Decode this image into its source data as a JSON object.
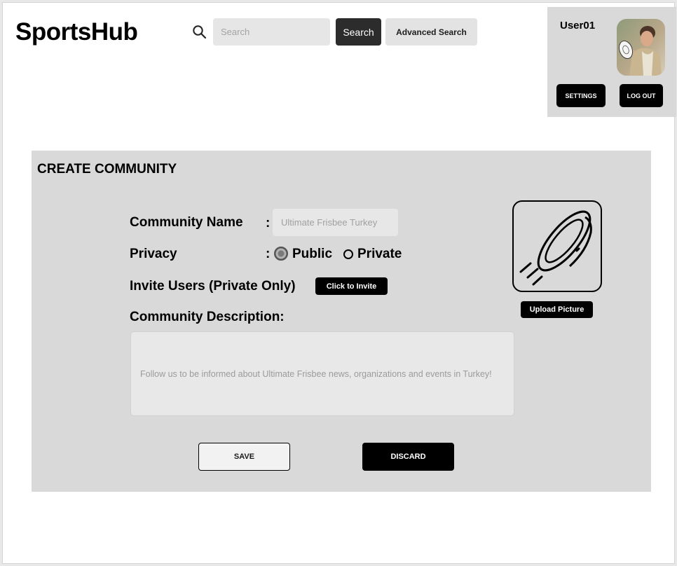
{
  "header": {
    "logo": "SportsHub",
    "search_placeholder": "Search",
    "search_button": "Search",
    "advanced_search_button": "Advanced Search",
    "search_icon": "search-icon"
  },
  "user_panel": {
    "username": "User01",
    "settings_button": "SETTINGS",
    "logout_button": "LOG OUT"
  },
  "form": {
    "title": "CREATE COMMUNITY",
    "name_label": "Community Name",
    "name_placeholder": "Ultimate Frisbee Turkey",
    "privacy_label": "Privacy",
    "colon": ":",
    "privacy_options": [
      {
        "label": "Public",
        "selected": true
      },
      {
        "label": "Private",
        "selected": false
      }
    ],
    "invite_label": "Invite Users (Private Only)",
    "invite_button": "Click to Invite",
    "description_label": "Community Description:",
    "description_placeholder": "Follow us to be informed about Ultimate Frisbee news, organizations and events in Turkey!",
    "upload_icon": "frisbee-icon",
    "upload_button": "Upload Picture",
    "save_button": "SAVE",
    "discard_button": "DISCARD"
  }
}
